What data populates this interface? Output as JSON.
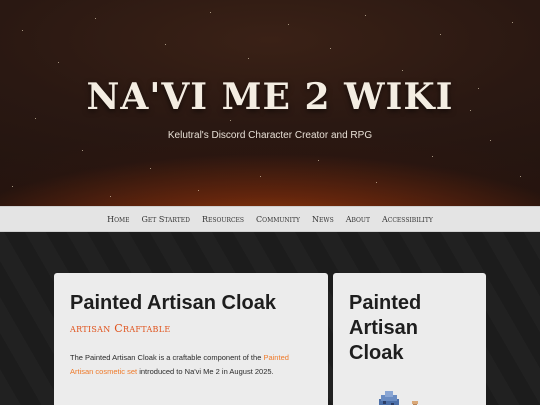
{
  "hero": {
    "title": "NA'VI ME 2 WIKI",
    "subtitle": "Kelutral's Discord Character Creator and RPG"
  },
  "nav": {
    "items": [
      "Home",
      "Get Started",
      "Resources",
      "Community",
      "News",
      "About",
      "Accessibility"
    ]
  },
  "article": {
    "title": "Painted Artisan Cloak",
    "category": "artisan Craftable",
    "text_before_link": "The Painted Artisan Cloak is a craftable component of the",
    "link_text": "Painted Artisan cosmetic set",
    "text_after_link": "introduced to Na'vi Me 2 in August 2025."
  },
  "infobox": {
    "title": "Painted Artisan Cloak",
    "image_icon": "cloak-sprite-icon"
  },
  "colors": {
    "accent": "#e0521b",
    "link": "#ef7a2a",
    "nav_bg": "#e4e4e4",
    "card_bg": "#ececec"
  }
}
